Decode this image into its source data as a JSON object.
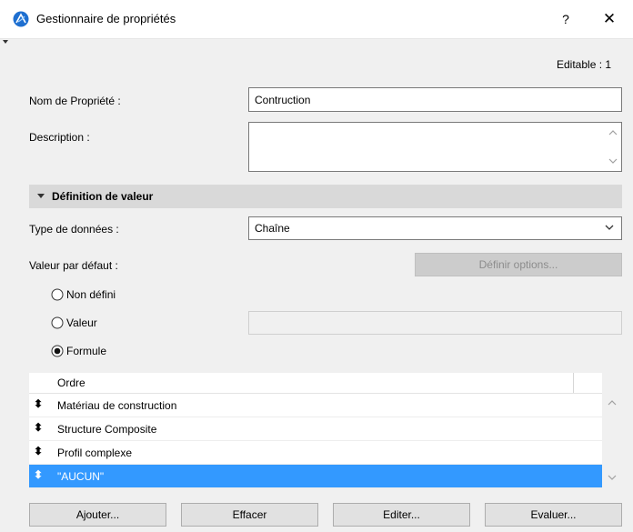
{
  "window": {
    "title": "Gestionnaire de propriétés",
    "help_label": "?",
    "close_label": "✕"
  },
  "header": {
    "editable_label": "Editable : 1"
  },
  "form": {
    "name_label": "Nom de Propriété :",
    "name_value": "Contruction",
    "description_label": "Description :",
    "description_value": ""
  },
  "section": {
    "title": "Définition de valeur",
    "type_label": "Type de données :",
    "type_value": "Chaîne",
    "default_label": "Valeur par défaut :",
    "define_options_label": "Définir options...",
    "radios": [
      {
        "label": "Non défini",
        "checked": false
      },
      {
        "label": "Valeur",
        "checked": false
      },
      {
        "label": "Formule",
        "checked": true
      }
    ]
  },
  "list": {
    "column_header": "Ordre",
    "rows": [
      {
        "text": "Matériau de construction",
        "selected": false
      },
      {
        "text": "Structure Composite",
        "selected": false
      },
      {
        "text": "Profil complexe",
        "selected": false
      },
      {
        "text": "\"AUCUN\"",
        "selected": true
      }
    ]
  },
  "buttons": {
    "add": "Ajouter...",
    "delete": "Effacer",
    "edit": "Editer...",
    "evaluate": "Evaluer..."
  },
  "colors": {
    "accent": "#3399ff",
    "app_icon": "#1e6fd0"
  }
}
